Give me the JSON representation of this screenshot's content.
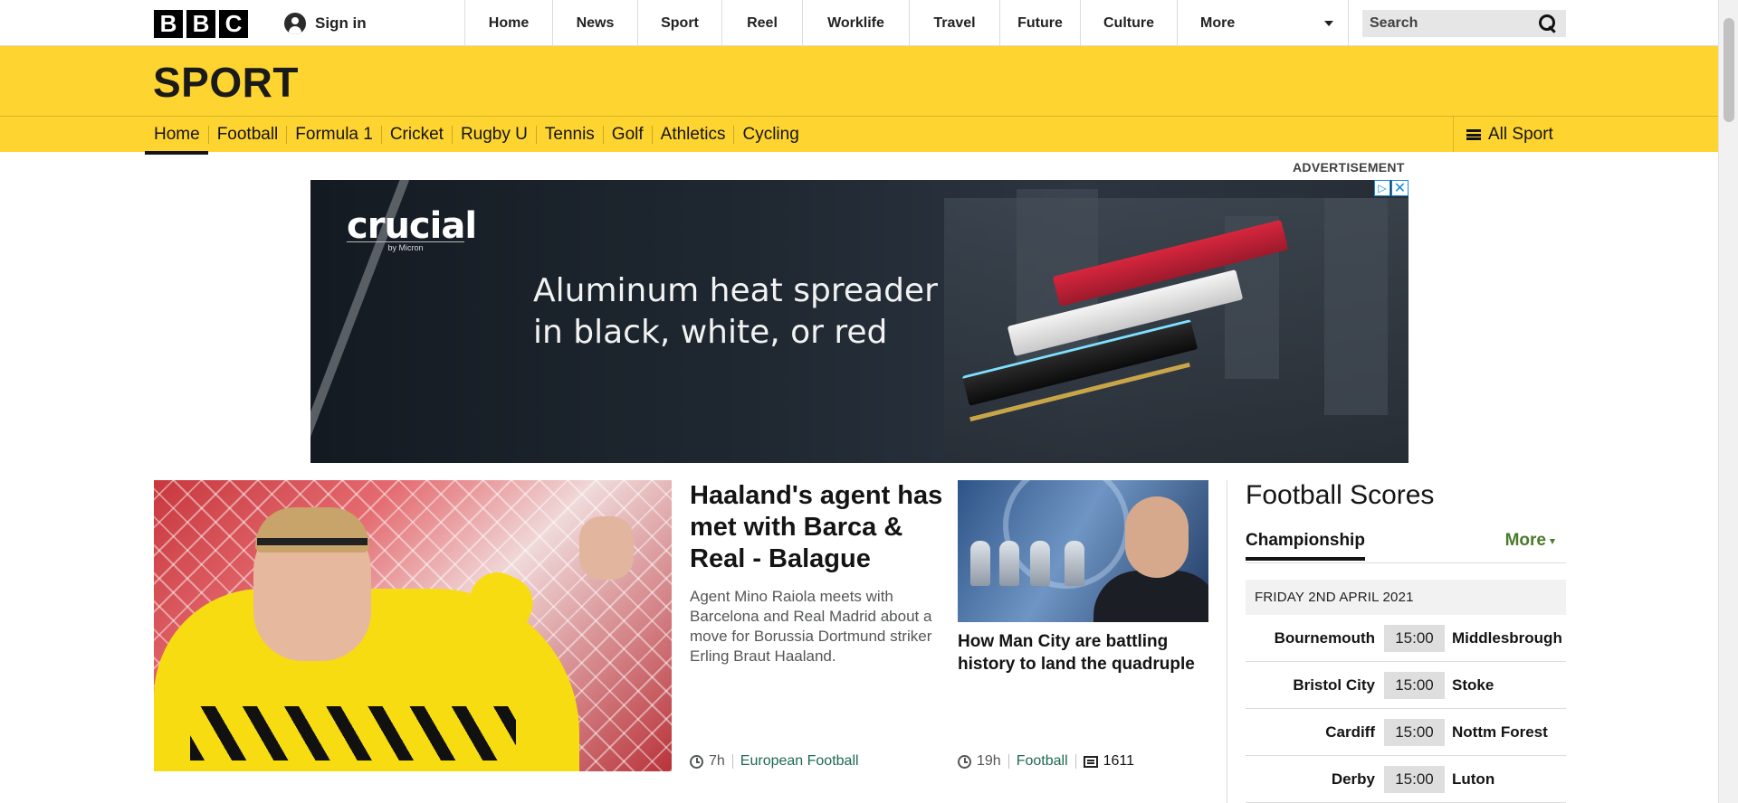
{
  "topbar": {
    "logo_letters": [
      "B",
      "B",
      "C"
    ],
    "sign_in": "Sign in",
    "nav": [
      "Home",
      "News",
      "Sport",
      "Reel",
      "Worklife",
      "Travel",
      "Future",
      "Culture",
      "More"
    ],
    "search_placeholder": "Search"
  },
  "sport": {
    "title": "SPORT",
    "nav": [
      "Home",
      "Football",
      "Formula 1",
      "Cricket",
      "Rugby U",
      "Tennis",
      "Golf",
      "Athletics",
      "Cycling"
    ],
    "active": "Home",
    "all_sport": "All Sport"
  },
  "advert": {
    "label": "ADVERTISEMENT",
    "brand": "crucial",
    "brand_sub": "by Micron",
    "headline_line1": "Aluminum heat spreader",
    "headline_line2": "in black, white, or red",
    "choice_icon": "▷",
    "close_icon": "✕"
  },
  "lead_story": {
    "title": "Haaland's agent has met with Barca & Real - Balague",
    "summary": "Agent Mino Raiola meets with Barcelona and Real Madrid about a move for Borussia Dortmund striker Erling Braut Haaland.",
    "time": "7h",
    "tag": "European Football"
  },
  "second_story": {
    "title": "How Man City are battling history to land the quadruple",
    "time": "19h",
    "tag": "Football",
    "comments": "1611"
  },
  "scores": {
    "title": "Football Scores",
    "tab": "Championship",
    "more": "More",
    "date": "FRIDAY 2ND APRIL 2021",
    "matches": [
      {
        "home": "Bournemouth",
        "time": "15:00",
        "away": "Middlesbrough"
      },
      {
        "home": "Bristol City",
        "time": "15:00",
        "away": "Stoke"
      },
      {
        "home": "Cardiff",
        "time": "15:00",
        "away": "Nottm Forest"
      },
      {
        "home": "Derby",
        "time": "15:00",
        "away": "Luton"
      }
    ]
  },
  "colors": {
    "sport_yellow": "#fed430",
    "tag_green": "#1e6a4f",
    "more_green": "#4b7a2a"
  }
}
